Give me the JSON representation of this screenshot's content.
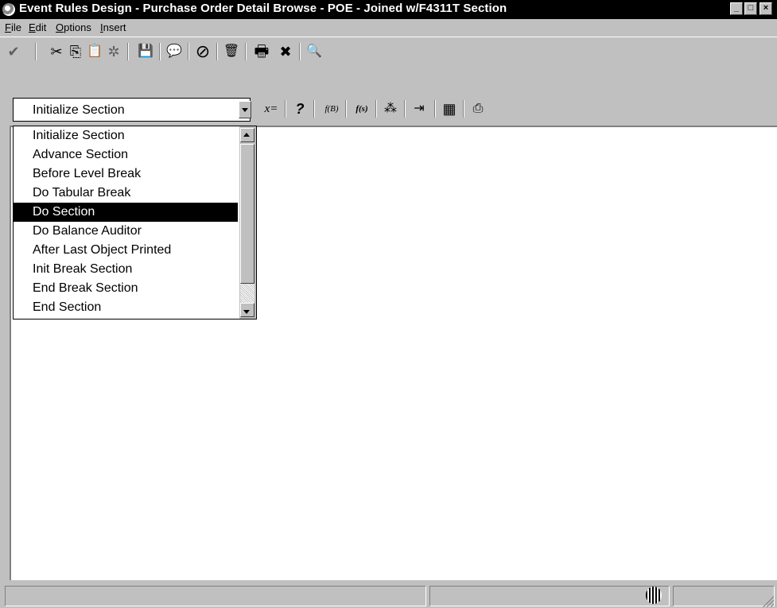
{
  "window": {
    "title": "Event Rules Design - Purchase Order Detail Browse - POE - Joined w/F4311T Section",
    "controls": {
      "minimize": "_",
      "maximize": "□",
      "close": "×"
    }
  },
  "menubar": [
    {
      "label": "File",
      "accel": "F",
      "rest": "ile"
    },
    {
      "label": "Edit",
      "accel": "E",
      "rest": "dit"
    },
    {
      "label": "Options",
      "accel": "O",
      "rest": "ptions"
    },
    {
      "label": "Insert",
      "accel": "I",
      "rest": "nsert"
    }
  ],
  "toolbar1": {
    "icons": [
      {
        "name": "checkmark-icon",
        "glyph": "✔"
      },
      {
        "name": "cut-icon",
        "glyph": "✂"
      },
      {
        "name": "copy-icon",
        "glyph": "⎘"
      },
      {
        "name": "paste-icon",
        "glyph": "📋"
      },
      {
        "name": "paste-special-icon",
        "glyph": "✲"
      },
      {
        "name": "save-icon",
        "glyph": "💾"
      },
      {
        "name": "comment-icon",
        "glyph": "💬"
      },
      {
        "name": "no-icon",
        "glyph": "⊘"
      },
      {
        "name": "delete-icon",
        "glyph": "🗑"
      },
      {
        "name": "print-icon",
        "glyph": "🖶"
      },
      {
        "name": "cancel-icon",
        "glyph": "✖"
      },
      {
        "name": "search-icon",
        "glyph": "🔍"
      }
    ]
  },
  "toolbar2": {
    "event_combo": {
      "selected": "Initialize Section"
    },
    "icons": [
      {
        "name": "assignment-icon",
        "glyph": "x="
      },
      {
        "name": "if-icon",
        "glyph": "?"
      },
      {
        "name": "business-function-icon",
        "glyph": "f(B)"
      },
      {
        "name": "system-function-icon",
        "glyph": "f(s)"
      },
      {
        "name": "variables-icon",
        "glyph": "⁂"
      },
      {
        "name": "insert-line-icon",
        "glyph": "⇥"
      },
      {
        "name": "table-io-icon",
        "glyph": "▦"
      },
      {
        "name": "attachment-icon",
        "glyph": "⎙"
      }
    ]
  },
  "dropdown": {
    "items": [
      "Initialize Section",
      "Advance Section",
      "Before Level Break",
      "Do Tabular Break",
      "Do Section",
      "Do Balance Auditor",
      "After Last Object Printed",
      "Init Break Section",
      "End Break Section",
      "End Section"
    ],
    "selected_index": 4
  },
  "statusbar": {
    "panes": [
      "",
      "",
      ""
    ]
  }
}
